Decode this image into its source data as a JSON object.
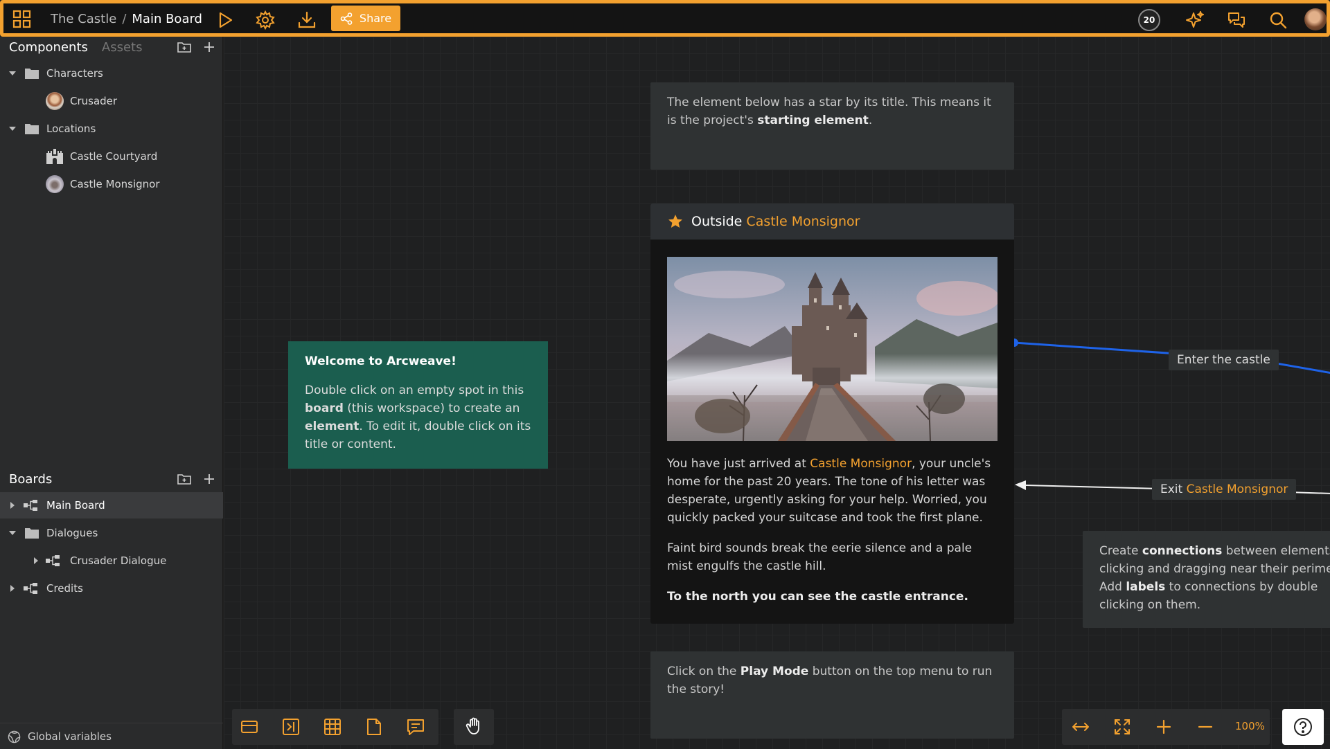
{
  "topbar": {
    "project": "The Castle",
    "separator": "/",
    "board": "Main Board",
    "share_label": "Share",
    "credits_badge": "20",
    "icons": [
      "apps-grid-icon",
      "play-icon",
      "settings-icon",
      "download-icon",
      "share-icon",
      "sparkle-icon",
      "comments-icon",
      "search-icon",
      "user-avatar"
    ]
  },
  "sidebar": {
    "components_tab": "Components",
    "assets_tab": "Assets",
    "components": [
      {
        "label": "Characters",
        "type": "folder",
        "expanded": true
      },
      {
        "label": "Crusader",
        "type": "component"
      },
      {
        "label": "Locations",
        "type": "folder",
        "expanded": true
      },
      {
        "label": "Castle Courtyard",
        "type": "component"
      },
      {
        "label": "Castle Monsignor",
        "type": "component"
      }
    ],
    "boards_title": "Boards",
    "boards": [
      {
        "label": "Main Board",
        "selected": true
      },
      {
        "label": "Dialogues",
        "type": "folder"
      },
      {
        "label": "Crusader Dialogue"
      },
      {
        "label": "Credits"
      }
    ],
    "global_variables": "Global variables"
  },
  "canvas": {
    "note_top": {
      "text_1": "The element below has a star by its title. This means it is the project's ",
      "bold": "starting element",
      "text_2": "."
    },
    "welcome": {
      "title": "Welcome to Arcweave!",
      "t1": "Double click on an empty spot in this ",
      "b1": "board",
      "t2": " (this workspace) to create an ",
      "b2": "element",
      "t3": ". To edit it, double click on its title or content."
    },
    "element": {
      "title_prefix": "Outside ",
      "title_link": "Castle Monsignor",
      "p1_a": "You have just arrived at ",
      "p1_link": "Castle Monsignor",
      "p1_b": ", your uncle's home for the past 20 years. The tone of his letter was desperate, urgently asking for your help. Worried, you quickly packed your suitcase and took the first plane.",
      "p2": "Faint bird sounds break the eerie silence and a pale mist engulfs the castle hill.",
      "p3": "To the north you can see the castle entrance."
    },
    "connections": {
      "enter_label": "Enter the castle",
      "exit_prefix": "Exit ",
      "exit_link": "Castle Monsignor"
    },
    "note_right": {
      "t1": "Create ",
      "b1": "connections",
      "t2": " between elements b",
      "line2": "clicking and dragging near their perimete",
      "t3": "Add ",
      "b2": "labels",
      "t4": " to connections by double",
      "line4": "clicking on them."
    },
    "note_bottom": {
      "t1": "Click on the ",
      "b1": "Play Mode",
      "t2": " button on the top menu to run the story!"
    }
  },
  "bottom_toolbar": {
    "tools": [
      "element-tool-icon",
      "jumper-tool-icon",
      "table-tool-icon",
      "note-tool-icon",
      "comment-tool-icon"
    ],
    "hand": "hand-tool-icon",
    "zoom_label": "100%"
  },
  "colors": {
    "accent": "#f3a12f",
    "connection_blue": "#1e63e9",
    "welcome_green": "#1b5e4f"
  }
}
